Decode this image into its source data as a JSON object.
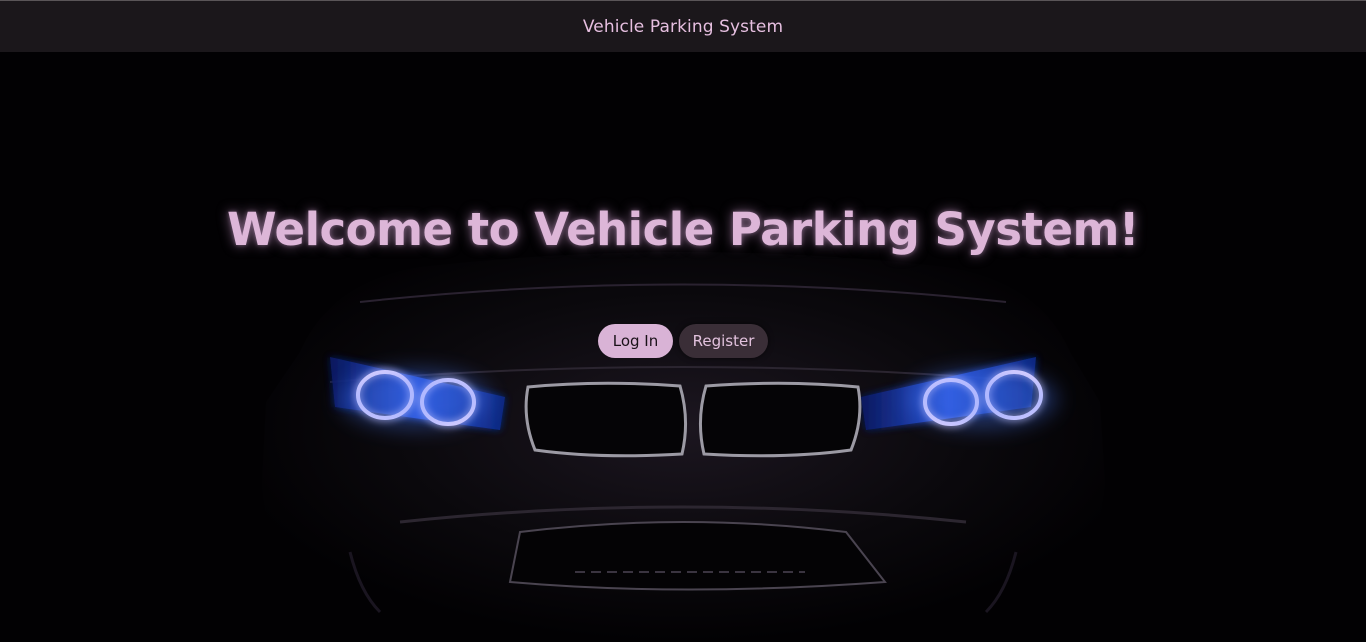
{
  "header": {
    "title": "Vehicle Parking System"
  },
  "hero": {
    "heading": "Welcome to Vehicle Parking System!",
    "image": "car-front-headlights-image"
  },
  "actions": {
    "login_label": "Log In",
    "register_label": "Register"
  },
  "colors": {
    "accent": "#d9b3d6",
    "header_bg": "#1b171b",
    "background": "#020103",
    "secondary_button": "#3a2e37",
    "headlight_glow": "#3a78ff"
  }
}
